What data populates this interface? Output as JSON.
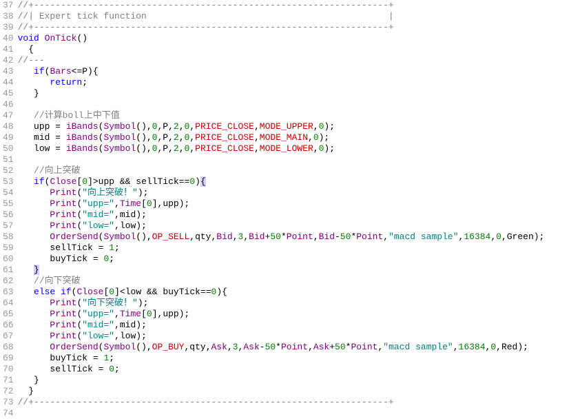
{
  "startLine": 37,
  "lines": [
    {
      "num": 37,
      "tokens": [
        {
          "t": "//+------------------------------------------------------------------+",
          "c": "c-comment"
        }
      ]
    },
    {
      "num": 38,
      "tokens": [
        {
          "t": "//| Expert tick function                                             |",
          "c": "c-comment"
        }
      ]
    },
    {
      "num": 39,
      "tokens": [
        {
          "t": "//+------------------------------------------------------------------+",
          "c": "c-comment"
        }
      ]
    },
    {
      "num": 40,
      "tokens": [
        {
          "t": "void",
          "c": "c-keyword"
        },
        {
          "t": " ",
          "c": ""
        },
        {
          "t": "OnTick",
          "c": "c-func"
        },
        {
          "t": "()",
          "c": "c-punct"
        }
      ]
    },
    {
      "num": 41,
      "tokens": [
        {
          "t": "  {",
          "c": "c-punct"
        }
      ]
    },
    {
      "num": 42,
      "tokens": [
        {
          "t": "//---",
          "c": "c-comment"
        }
      ]
    },
    {
      "num": 43,
      "tokens": [
        {
          "t": "   ",
          "c": ""
        },
        {
          "t": "if",
          "c": "c-keyword"
        },
        {
          "t": "(",
          "c": "c-punct"
        },
        {
          "t": "Bars",
          "c": "c-var"
        },
        {
          "t": "<=P){",
          "c": "c-punct"
        }
      ]
    },
    {
      "num": 44,
      "tokens": [
        {
          "t": "      ",
          "c": ""
        },
        {
          "t": "return",
          "c": "c-keyword"
        },
        {
          "t": ";",
          "c": "c-punct"
        }
      ]
    },
    {
      "num": 45,
      "tokens": [
        {
          "t": "   }",
          "c": "c-punct"
        }
      ]
    },
    {
      "num": 46,
      "tokens": [
        {
          "t": "",
          "c": ""
        }
      ]
    },
    {
      "num": 47,
      "tokens": [
        {
          "t": "   ",
          "c": ""
        },
        {
          "t": "//计算boll上中下值",
          "c": "c-comment"
        }
      ]
    },
    {
      "num": 48,
      "tokens": [
        {
          "t": "   upp = ",
          "c": "c-punct"
        },
        {
          "t": "iBands",
          "c": "c-func"
        },
        {
          "t": "(",
          "c": "c-punct"
        },
        {
          "t": "Symbol",
          "c": "c-func"
        },
        {
          "t": "(),",
          "c": "c-punct"
        },
        {
          "t": "0",
          "c": "c-number"
        },
        {
          "t": ",P,",
          "c": "c-punct"
        },
        {
          "t": "2",
          "c": "c-number"
        },
        {
          "t": ",",
          "c": "c-punct"
        },
        {
          "t": "0",
          "c": "c-number"
        },
        {
          "t": ",",
          "c": "c-punct"
        },
        {
          "t": "PRICE_CLOSE",
          "c": "c-const"
        },
        {
          "t": ",",
          "c": "c-punct"
        },
        {
          "t": "MODE_UPPER",
          "c": "c-const"
        },
        {
          "t": ",",
          "c": "c-punct"
        },
        {
          "t": "0",
          "c": "c-number"
        },
        {
          "t": ");",
          "c": "c-punct"
        }
      ]
    },
    {
      "num": 49,
      "tokens": [
        {
          "t": "   mid = ",
          "c": "c-punct"
        },
        {
          "t": "iBands",
          "c": "c-func"
        },
        {
          "t": "(",
          "c": "c-punct"
        },
        {
          "t": "Symbol",
          "c": "c-func"
        },
        {
          "t": "(),",
          "c": "c-punct"
        },
        {
          "t": "0",
          "c": "c-number"
        },
        {
          "t": ",P,",
          "c": "c-punct"
        },
        {
          "t": "2",
          "c": "c-number"
        },
        {
          "t": ",",
          "c": "c-punct"
        },
        {
          "t": "0",
          "c": "c-number"
        },
        {
          "t": ",",
          "c": "c-punct"
        },
        {
          "t": "PRICE_CLOSE",
          "c": "c-const"
        },
        {
          "t": ",",
          "c": "c-punct"
        },
        {
          "t": "MODE_MAIN",
          "c": "c-const"
        },
        {
          "t": ",",
          "c": "c-punct"
        },
        {
          "t": "0",
          "c": "c-number"
        },
        {
          "t": ");",
          "c": "c-punct"
        }
      ]
    },
    {
      "num": 50,
      "tokens": [
        {
          "t": "   low = ",
          "c": "c-punct"
        },
        {
          "t": "iBands",
          "c": "c-func"
        },
        {
          "t": "(",
          "c": "c-punct"
        },
        {
          "t": "Symbol",
          "c": "c-func"
        },
        {
          "t": "(),",
          "c": "c-punct"
        },
        {
          "t": "0",
          "c": "c-number"
        },
        {
          "t": ",P,",
          "c": "c-punct"
        },
        {
          "t": "2",
          "c": "c-number"
        },
        {
          "t": ",",
          "c": "c-punct"
        },
        {
          "t": "0",
          "c": "c-number"
        },
        {
          "t": ",",
          "c": "c-punct"
        },
        {
          "t": "PRICE_CLOSE",
          "c": "c-const"
        },
        {
          "t": ",",
          "c": "c-punct"
        },
        {
          "t": "MODE_LOWER",
          "c": "c-const"
        },
        {
          "t": ",",
          "c": "c-punct"
        },
        {
          "t": "0",
          "c": "c-number"
        },
        {
          "t": ");",
          "c": "c-punct"
        }
      ]
    },
    {
      "num": 51,
      "tokens": [
        {
          "t": "",
          "c": ""
        }
      ]
    },
    {
      "num": 52,
      "tokens": [
        {
          "t": "   ",
          "c": ""
        },
        {
          "t": "//向上突破",
          "c": "c-comment"
        }
      ]
    },
    {
      "num": 53,
      "tokens": [
        {
          "t": "   ",
          "c": ""
        },
        {
          "t": "if",
          "c": "c-keyword"
        },
        {
          "t": "(",
          "c": "c-punct"
        },
        {
          "t": "Close",
          "c": "c-var"
        },
        {
          "t": "[",
          "c": "c-punct"
        },
        {
          "t": "0",
          "c": "c-number"
        },
        {
          "t": "]>upp && sellTick==",
          "c": "c-punct"
        },
        {
          "t": "0",
          "c": "c-number"
        },
        {
          "t": ")",
          "c": "c-punct"
        },
        {
          "t": "{",
          "c": "c-punct c-brace-hl"
        }
      ]
    },
    {
      "num": 54,
      "tokens": [
        {
          "t": "      ",
          "c": ""
        },
        {
          "t": "Print",
          "c": "c-func"
        },
        {
          "t": "(",
          "c": "c-punct"
        },
        {
          "t": "\"向上突破！\"",
          "c": "c-string"
        },
        {
          "t": ");",
          "c": "c-punct"
        }
      ]
    },
    {
      "num": 55,
      "tokens": [
        {
          "t": "      ",
          "c": ""
        },
        {
          "t": "Print",
          "c": "c-func"
        },
        {
          "t": "(",
          "c": "c-punct"
        },
        {
          "t": "\"upp=\"",
          "c": "c-string"
        },
        {
          "t": ",",
          "c": "c-punct"
        },
        {
          "t": "Time",
          "c": "c-var"
        },
        {
          "t": "[",
          "c": "c-punct"
        },
        {
          "t": "0",
          "c": "c-number"
        },
        {
          "t": "],upp);",
          "c": "c-punct"
        }
      ]
    },
    {
      "num": 56,
      "tokens": [
        {
          "t": "      ",
          "c": ""
        },
        {
          "t": "Print",
          "c": "c-func"
        },
        {
          "t": "(",
          "c": "c-punct"
        },
        {
          "t": "\"mid=\"",
          "c": "c-string"
        },
        {
          "t": ",mid);",
          "c": "c-punct"
        }
      ]
    },
    {
      "num": 57,
      "tokens": [
        {
          "t": "      ",
          "c": ""
        },
        {
          "t": "Print",
          "c": "c-func"
        },
        {
          "t": "(",
          "c": "c-punct"
        },
        {
          "t": "\"low=\"",
          "c": "c-string"
        },
        {
          "t": ",low);",
          "c": "c-punct"
        }
      ]
    },
    {
      "num": 58,
      "tokens": [
        {
          "t": "      ",
          "c": ""
        },
        {
          "t": "OrderSend",
          "c": "c-func"
        },
        {
          "t": "(",
          "c": "c-punct"
        },
        {
          "t": "Symbol",
          "c": "c-func"
        },
        {
          "t": "(),",
          "c": "c-punct"
        },
        {
          "t": "OP_SELL",
          "c": "c-const"
        },
        {
          "t": ",qty,",
          "c": "c-punct"
        },
        {
          "t": "Bid",
          "c": "c-var"
        },
        {
          "t": ",",
          "c": "c-punct"
        },
        {
          "t": "3",
          "c": "c-number"
        },
        {
          "t": ",",
          "c": "c-punct"
        },
        {
          "t": "Bid",
          "c": "c-var"
        },
        {
          "t": "+",
          "c": "c-punct"
        },
        {
          "t": "50",
          "c": "c-number"
        },
        {
          "t": "*",
          "c": "c-punct"
        },
        {
          "t": "Point",
          "c": "c-var"
        },
        {
          "t": ",",
          "c": "c-punct"
        },
        {
          "t": "Bid",
          "c": "c-var"
        },
        {
          "t": "-",
          "c": "c-punct"
        },
        {
          "t": "50",
          "c": "c-number"
        },
        {
          "t": "*",
          "c": "c-punct"
        },
        {
          "t": "Point",
          "c": "c-var"
        },
        {
          "t": ",",
          "c": "c-punct"
        },
        {
          "t": "\"macd sample\"",
          "c": "c-string"
        },
        {
          "t": ",",
          "c": "c-punct"
        },
        {
          "t": "16384",
          "c": "c-number"
        },
        {
          "t": ",",
          "c": "c-punct"
        },
        {
          "t": "0",
          "c": "c-number"
        },
        {
          "t": ",Green);",
          "c": "c-punct"
        }
      ]
    },
    {
      "num": 59,
      "tokens": [
        {
          "t": "      sellTick = ",
          "c": "c-punct"
        },
        {
          "t": "1",
          "c": "c-number"
        },
        {
          "t": ";",
          "c": "c-punct"
        }
      ]
    },
    {
      "num": 60,
      "tokens": [
        {
          "t": "      buyTick = ",
          "c": "c-punct"
        },
        {
          "t": "0",
          "c": "c-number"
        },
        {
          "t": ";",
          "c": "c-punct"
        }
      ]
    },
    {
      "num": 61,
      "tokens": [
        {
          "t": "   ",
          "c": ""
        },
        {
          "t": "}",
          "c": "c-punct c-brace-hl"
        }
      ]
    },
    {
      "num": 62,
      "tokens": [
        {
          "t": "   ",
          "c": ""
        },
        {
          "t": "//向下突破",
          "c": "c-comment"
        }
      ]
    },
    {
      "num": 63,
      "tokens": [
        {
          "t": "   ",
          "c": ""
        },
        {
          "t": "else",
          "c": "c-keyword"
        },
        {
          "t": " ",
          "c": ""
        },
        {
          "t": "if",
          "c": "c-keyword"
        },
        {
          "t": "(",
          "c": "c-punct"
        },
        {
          "t": "Close",
          "c": "c-var"
        },
        {
          "t": "[",
          "c": "c-punct"
        },
        {
          "t": "0",
          "c": "c-number"
        },
        {
          "t": "]<low && buyTick==",
          "c": "c-punct"
        },
        {
          "t": "0",
          "c": "c-number"
        },
        {
          "t": "){",
          "c": "c-punct"
        }
      ]
    },
    {
      "num": 64,
      "tokens": [
        {
          "t": "      ",
          "c": ""
        },
        {
          "t": "Print",
          "c": "c-func"
        },
        {
          "t": "(",
          "c": "c-punct"
        },
        {
          "t": "\"向下突破！\"",
          "c": "c-string"
        },
        {
          "t": ");",
          "c": "c-punct"
        }
      ]
    },
    {
      "num": 65,
      "tokens": [
        {
          "t": "      ",
          "c": ""
        },
        {
          "t": "Print",
          "c": "c-func"
        },
        {
          "t": "(",
          "c": "c-punct"
        },
        {
          "t": "\"upp=\"",
          "c": "c-string"
        },
        {
          "t": ",",
          "c": "c-punct"
        },
        {
          "t": "Time",
          "c": "c-var"
        },
        {
          "t": "[",
          "c": "c-punct"
        },
        {
          "t": "0",
          "c": "c-number"
        },
        {
          "t": "],upp);",
          "c": "c-punct"
        }
      ]
    },
    {
      "num": 66,
      "tokens": [
        {
          "t": "      ",
          "c": ""
        },
        {
          "t": "Print",
          "c": "c-func"
        },
        {
          "t": "(",
          "c": "c-punct"
        },
        {
          "t": "\"mid=\"",
          "c": "c-string"
        },
        {
          "t": ",mid);",
          "c": "c-punct"
        }
      ]
    },
    {
      "num": 67,
      "tokens": [
        {
          "t": "      ",
          "c": ""
        },
        {
          "t": "Print",
          "c": "c-func"
        },
        {
          "t": "(",
          "c": "c-punct"
        },
        {
          "t": "\"low=\"",
          "c": "c-string"
        },
        {
          "t": ",low);",
          "c": "c-punct"
        }
      ]
    },
    {
      "num": 68,
      "tokens": [
        {
          "t": "      ",
          "c": ""
        },
        {
          "t": "OrderSend",
          "c": "c-func"
        },
        {
          "t": "(",
          "c": "c-punct"
        },
        {
          "t": "Symbol",
          "c": "c-func"
        },
        {
          "t": "(),",
          "c": "c-punct"
        },
        {
          "t": "OP_BUY",
          "c": "c-const"
        },
        {
          "t": ",qty,",
          "c": "c-punct"
        },
        {
          "t": "Ask",
          "c": "c-var"
        },
        {
          "t": ",",
          "c": "c-punct"
        },
        {
          "t": "3",
          "c": "c-number"
        },
        {
          "t": ",",
          "c": "c-punct"
        },
        {
          "t": "Ask",
          "c": "c-var"
        },
        {
          "t": "-",
          "c": "c-punct"
        },
        {
          "t": "50",
          "c": "c-number"
        },
        {
          "t": "*",
          "c": "c-punct"
        },
        {
          "t": "Point",
          "c": "c-var"
        },
        {
          "t": ",",
          "c": "c-punct"
        },
        {
          "t": "Ask",
          "c": "c-var"
        },
        {
          "t": "+",
          "c": "c-punct"
        },
        {
          "t": "50",
          "c": "c-number"
        },
        {
          "t": "*",
          "c": "c-punct"
        },
        {
          "t": "Point",
          "c": "c-var"
        },
        {
          "t": ",",
          "c": "c-punct"
        },
        {
          "t": "\"macd sample\"",
          "c": "c-string"
        },
        {
          "t": ",",
          "c": "c-punct"
        },
        {
          "t": "16384",
          "c": "c-number"
        },
        {
          "t": ",",
          "c": "c-punct"
        },
        {
          "t": "0",
          "c": "c-number"
        },
        {
          "t": ",Red);",
          "c": "c-punct"
        }
      ]
    },
    {
      "num": 69,
      "tokens": [
        {
          "t": "      buyTick = ",
          "c": "c-punct"
        },
        {
          "t": "1",
          "c": "c-number"
        },
        {
          "t": ";",
          "c": "c-punct"
        }
      ]
    },
    {
      "num": 70,
      "tokens": [
        {
          "t": "      sellTick = ",
          "c": "c-punct"
        },
        {
          "t": "0",
          "c": "c-number"
        },
        {
          "t": ";",
          "c": "c-punct"
        }
      ]
    },
    {
      "num": 71,
      "tokens": [
        {
          "t": "   }",
          "c": "c-punct"
        }
      ]
    },
    {
      "num": 72,
      "tokens": [
        {
          "t": "  }",
          "c": "c-punct"
        }
      ]
    },
    {
      "num": 73,
      "tokens": [
        {
          "t": "//+------------------------------------------------------------------+",
          "c": "c-comment"
        }
      ]
    },
    {
      "num": 74,
      "tokens": [
        {
          "t": "",
          "c": ""
        }
      ]
    }
  ]
}
